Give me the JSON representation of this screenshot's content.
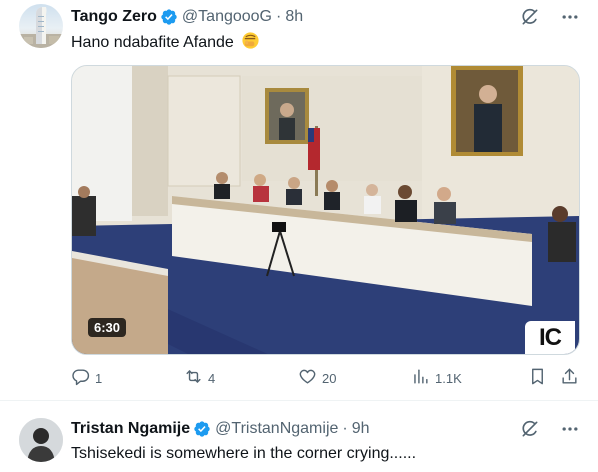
{
  "tweets": [
    {
      "author_name": "Tango Zero",
      "handle": "@TangoooG",
      "separator": "·",
      "time": "8h",
      "text": "Hano ndabafite Afande",
      "media": {
        "duration": "6:30",
        "watermark": "IC"
      },
      "stats": {
        "replies": "1",
        "reposts": "4",
        "likes": "20",
        "views": "1.1K"
      }
    },
    {
      "author_name": "Tristan Ngamije",
      "handle": "@TristanNgamije",
      "separator": "·",
      "time": "9h",
      "text": "Tshisekedi is somewhere in the corner crying......"
    }
  ],
  "icons": {
    "verified": "verified-badge-icon",
    "emoji": "face-with-hand-over-mouth-emoji",
    "grok": "grok-icon",
    "more": "more-icon",
    "reply": "reply-icon",
    "repost": "repost-icon",
    "like": "like-icon",
    "views": "views-icon",
    "bookmark": "bookmark-icon",
    "share": "share-icon"
  },
  "colors": {
    "verified_blue": "#1d9bf0",
    "secondary_text": "#536471",
    "primary_text": "#0f1419",
    "divider": "#eff3f4"
  }
}
